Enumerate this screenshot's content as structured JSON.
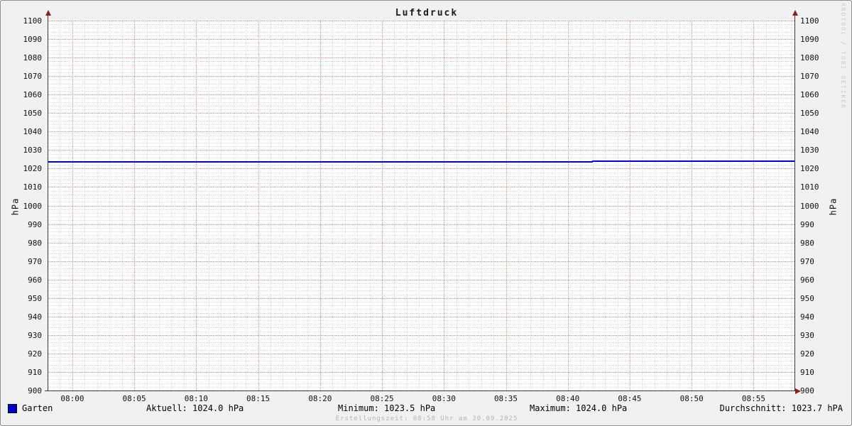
{
  "title": "Luftdruck",
  "watermark": "RRDTOOL / TOBI OETIKER",
  "axis": {
    "y_label_left": "hPa",
    "y_label_right": "hPa"
  },
  "footer": {
    "legend": {
      "label": "Garten",
      "color": "#0000cd"
    },
    "stats": {
      "aktuell": "Aktuell: 1024.0 hPa",
      "minimum": "Minimum: 1023.5 hPa",
      "maximum": "Maximum: 1024.0 hPa",
      "durchschnitt": "Durchschnitt: 1023.7 hPA"
    },
    "creation": "Erstellungszeit: 08:58 Uhr am 30.09.2025"
  },
  "chart_data": {
    "type": "line",
    "title": "Luftdruck",
    "ylabel": "hPa",
    "ylim": [
      900,
      1100
    ],
    "y_major_step": 10,
    "y_minor_step": 2,
    "y_ticks": [
      1100,
      1090,
      1080,
      1070,
      1060,
      1050,
      1040,
      1030,
      1020,
      1010,
      1000,
      990,
      980,
      970,
      960,
      950,
      940,
      930,
      920,
      910,
      900
    ],
    "x_ticks": [
      "08:00",
      "08:05",
      "08:10",
      "08:15",
      "08:20",
      "08:25",
      "08:30",
      "08:35",
      "08:40",
      "08:45",
      "08:50",
      "08:55"
    ],
    "x_start": "07:58",
    "x_end": "08:58",
    "x_minor_step_min": 1,
    "x_major_step_min": 5,
    "grid": true,
    "legend_position": "bottom",
    "series": [
      {
        "name": "Garten",
        "color": "#0000cd",
        "unit": "hPa",
        "points": [
          {
            "time": "07:58",
            "value": 1023.5
          },
          {
            "time": "08:42",
            "value": 1023.5
          },
          {
            "time": "08:42",
            "value": 1024.0
          },
          {
            "time": "08:58",
            "value": 1024.0
          }
        ]
      }
    ],
    "stats": {
      "aktuell_hpa": 1024.0,
      "minimum_hpa": 1023.5,
      "maximum_hpa": 1024.0,
      "durchschnitt_hpa": 1023.7
    }
  }
}
